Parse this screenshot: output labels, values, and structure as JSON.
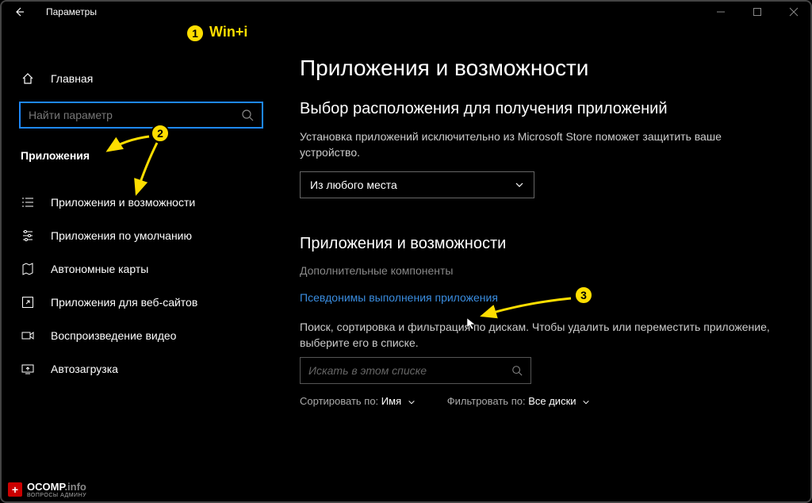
{
  "titlebar": {
    "title": "Параметры"
  },
  "annotations": {
    "badge1": "1",
    "badge1_label": "Win+i",
    "badge2": "2",
    "badge3": "3"
  },
  "sidebar": {
    "home": "Главная",
    "search_placeholder": "Найти параметр",
    "section": "Приложения",
    "items": [
      {
        "label": "Приложения и возможности"
      },
      {
        "label": "Приложения по умолчанию"
      },
      {
        "label": "Автономные карты"
      },
      {
        "label": "Приложения для веб-сайтов"
      },
      {
        "label": "Воспроизведение видео"
      },
      {
        "label": "Автозагрузка"
      }
    ]
  },
  "main": {
    "h1": "Приложения и возможности",
    "section1_title": "Выбор расположения для получения приложений",
    "section1_body": "Установка приложений исключительно из Microsoft Store поможет защитить ваше устройство.",
    "dropdown_value": "Из любого места",
    "section2_title": "Приложения и возможности",
    "optional_link": "Дополнительные компоненты",
    "aliases_link": "Псевдонимы выполнения приложения",
    "filter_body": "Поиск, сортировка и фильтрация по дискам. Чтобы удалить или переместить приложение, выберите его в списке.",
    "filter_placeholder": "Искать в этом списке",
    "sort_label": "Сортировать по:",
    "sort_value": "Имя",
    "filter_label": "Фильтровать по:",
    "filter_value": "Все диски"
  },
  "watermark": {
    "brand": "OCOMP",
    "tld": ".info",
    "sub": "ВОПРОСЫ АДМИНУ"
  }
}
